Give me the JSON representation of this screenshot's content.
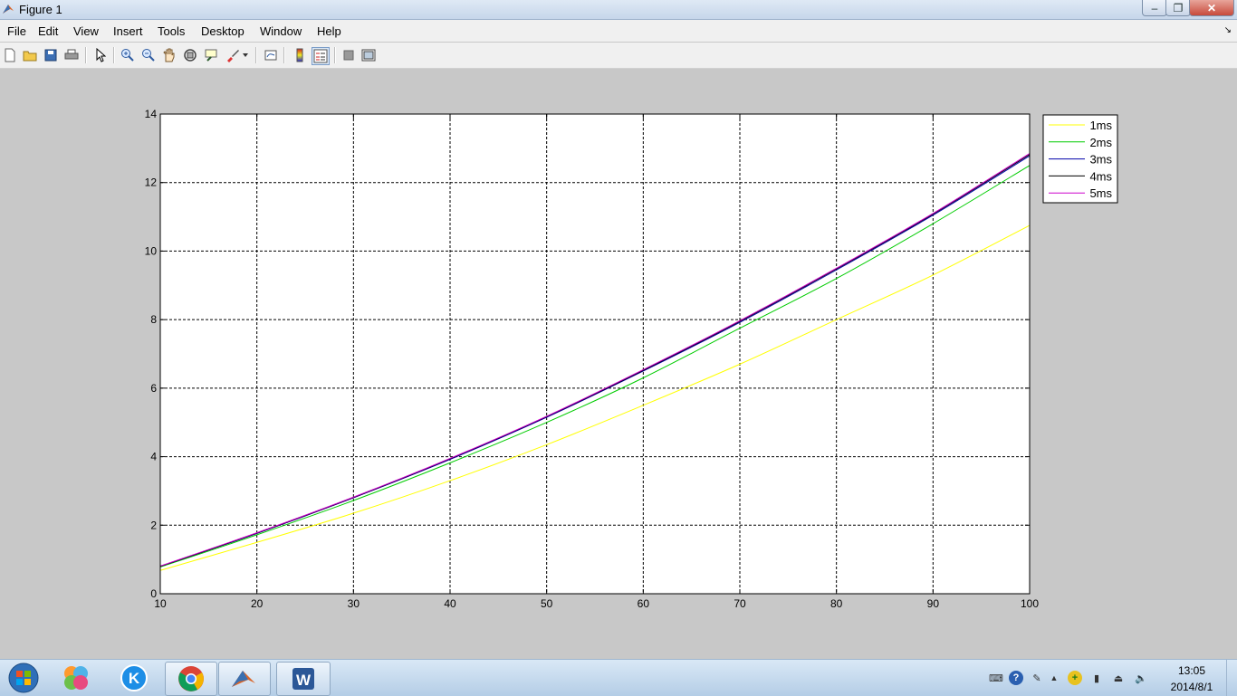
{
  "window": {
    "title": "Figure 1",
    "btn_min": "‒",
    "btn_max": "❐",
    "btn_close": "✕"
  },
  "menu": [
    "File",
    "Edit",
    "View",
    "Insert",
    "Tools",
    "Desktop",
    "Window",
    "Help"
  ],
  "menu_more": "↘",
  "toolbar": {
    "icons": [
      "new-figure-icon",
      "open-file-icon",
      "save-icon",
      "print-icon",
      "edit-plot-arrow-icon",
      "zoom-in-icon",
      "zoom-out-icon",
      "pan-hand-icon",
      "rotate-3d-icon",
      "data-cursor-icon",
      "brush-icon",
      "brush-dropdown-icon",
      "link-plot-icon",
      "colorbar-icon",
      "legend-icon",
      "hide-plot-tools-icon",
      "show-plot-tools-icon"
    ]
  },
  "chart_data": {
    "type": "line",
    "title": "",
    "xlabel": "",
    "ylabel": "",
    "xlim": [
      10,
      100
    ],
    "ylim": [
      0,
      14
    ],
    "xticks": [
      "10",
      "20",
      "30",
      "40",
      "50",
      "60",
      "70",
      "80",
      "90",
      "100"
    ],
    "yticks": [
      "0",
      "2",
      "4",
      "6",
      "8",
      "10",
      "12",
      "14"
    ],
    "grid": true,
    "legend_position": "outside-top-right",
    "x": [
      10,
      20,
      30,
      40,
      50,
      60,
      70,
      80,
      90,
      100
    ],
    "series": [
      {
        "name": "1ms",
        "color": "#ffff00",
        "values": [
          0.68,
          1.5,
          2.35,
          3.3,
          4.35,
          5.5,
          6.7,
          8.0,
          9.3,
          10.75
        ]
      },
      {
        "name": "2ms",
        "color": "#00cc00",
        "values": [
          0.78,
          1.72,
          2.72,
          3.82,
          5.0,
          6.3,
          7.75,
          9.2,
          10.8,
          12.5
        ]
      },
      {
        "name": "3ms",
        "color": "#0000aa",
        "values": [
          0.8,
          1.76,
          2.8,
          3.92,
          5.15,
          6.5,
          7.92,
          9.45,
          11.05,
          12.78
        ]
      },
      {
        "name": "4ms",
        "color": "#000000",
        "values": [
          0.8,
          1.77,
          2.81,
          3.94,
          5.17,
          6.52,
          7.95,
          9.48,
          11.08,
          12.82
        ]
      },
      {
        "name": "5ms",
        "color": "#cc00cc",
        "values": [
          0.81,
          1.78,
          2.82,
          3.95,
          5.18,
          6.54,
          7.97,
          9.5,
          11.1,
          12.85
        ]
      }
    ]
  },
  "taskbar": {
    "start": "start-orb-icon",
    "apps": [
      "app-colorful-icon",
      "kugou-icon",
      "chrome-icon",
      "matlab-icon",
      "word-icon"
    ],
    "word_letter": "W",
    "kugou_letter": "K",
    "tray": [
      "keyboard-icon",
      "help-icon",
      "language-icon",
      "show-hidden-arrow-icon",
      "network-plus-icon",
      "signal-icon",
      "usb-icon",
      "volume-icon"
    ],
    "tray_glyphs": [
      "⌨",
      "?",
      "✎",
      "▲",
      "+",
      "▮",
      "⏏",
      "🔈"
    ],
    "time": "13:05",
    "date": "2014/8/1"
  }
}
